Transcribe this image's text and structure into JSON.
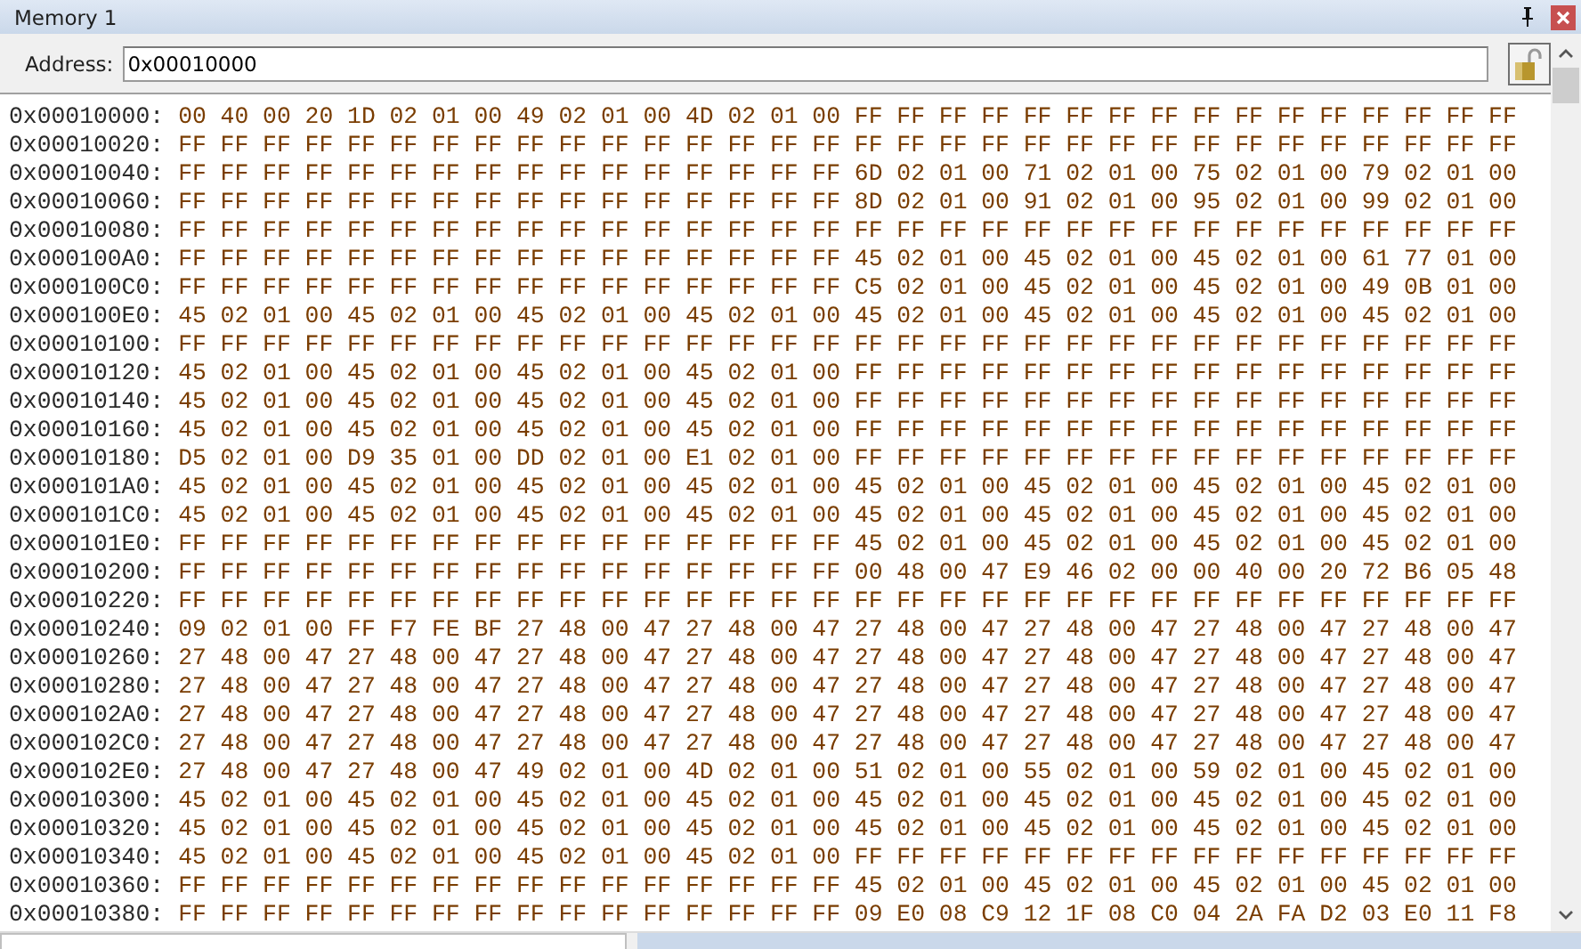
{
  "window": {
    "title": "Memory 1"
  },
  "address": {
    "label": "Address:",
    "value": "0x00010000"
  },
  "rows": [
    {
      "address": "0x00010000:",
      "bytes": "00 40 00 20 1D 02 01 00 49 02 01 00 4D 02 01 00 FF FF FF FF FF FF FF FF FF FF FF FF FF FF FF FF"
    },
    {
      "address": "0x00010020:",
      "bytes": "FF FF FF FF FF FF FF FF FF FF FF FF FF FF FF FF FF FF FF FF FF FF FF FF FF FF FF FF FF FF FF FF"
    },
    {
      "address": "0x00010040:",
      "bytes": "FF FF FF FF FF FF FF FF FF FF FF FF FF FF FF FF 6D 02 01 00 71 02 01 00 75 02 01 00 79 02 01 00"
    },
    {
      "address": "0x00010060:",
      "bytes": "FF FF FF FF FF FF FF FF FF FF FF FF FF FF FF FF 8D 02 01 00 91 02 01 00 95 02 01 00 99 02 01 00"
    },
    {
      "address": "0x00010080:",
      "bytes": "FF FF FF FF FF FF FF FF FF FF FF FF FF FF FF FF FF FF FF FF FF FF FF FF FF FF FF FF FF FF FF FF"
    },
    {
      "address": "0x000100A0:",
      "bytes": "FF FF FF FF FF FF FF FF FF FF FF FF FF FF FF FF 45 02 01 00 45 02 01 00 45 02 01 00 61 77 01 00"
    },
    {
      "address": "0x000100C0:",
      "bytes": "FF FF FF FF FF FF FF FF FF FF FF FF FF FF FF FF C5 02 01 00 45 02 01 00 45 02 01 00 49 0B 01 00"
    },
    {
      "address": "0x000100E0:",
      "bytes": "45 02 01 00 45 02 01 00 45 02 01 00 45 02 01 00 45 02 01 00 45 02 01 00 45 02 01 00 45 02 01 00"
    },
    {
      "address": "0x00010100:",
      "bytes": "FF FF FF FF FF FF FF FF FF FF FF FF FF FF FF FF FF FF FF FF FF FF FF FF FF FF FF FF FF FF FF FF"
    },
    {
      "address": "0x00010120:",
      "bytes": "45 02 01 00 45 02 01 00 45 02 01 00 45 02 01 00 FF FF FF FF FF FF FF FF FF FF FF FF FF FF FF FF"
    },
    {
      "address": "0x00010140:",
      "bytes": "45 02 01 00 45 02 01 00 45 02 01 00 45 02 01 00 FF FF FF FF FF FF FF FF FF FF FF FF FF FF FF FF"
    },
    {
      "address": "0x00010160:",
      "bytes": "45 02 01 00 45 02 01 00 45 02 01 00 45 02 01 00 FF FF FF FF FF FF FF FF FF FF FF FF FF FF FF FF"
    },
    {
      "address": "0x00010180:",
      "bytes": "D5 02 01 00 D9 35 01 00 DD 02 01 00 E1 02 01 00 FF FF FF FF FF FF FF FF FF FF FF FF FF FF FF FF"
    },
    {
      "address": "0x000101A0:",
      "bytes": "45 02 01 00 45 02 01 00 45 02 01 00 45 02 01 00 45 02 01 00 45 02 01 00 45 02 01 00 45 02 01 00"
    },
    {
      "address": "0x000101C0:",
      "bytes": "45 02 01 00 45 02 01 00 45 02 01 00 45 02 01 00 45 02 01 00 45 02 01 00 45 02 01 00 45 02 01 00"
    },
    {
      "address": "0x000101E0:",
      "bytes": "FF FF FF FF FF FF FF FF FF FF FF FF FF FF FF FF 45 02 01 00 45 02 01 00 45 02 01 00 45 02 01 00"
    },
    {
      "address": "0x00010200:",
      "bytes": "FF FF FF FF FF FF FF FF FF FF FF FF FF FF FF FF 00 48 00 47 E9 46 02 00 00 40 00 20 72 B6 05 48"
    },
    {
      "address": "0x00010220:",
      "bytes": "FF FF FF FF FF FF FF FF FF FF FF FF FF FF FF FF FF FF FF FF FF FF FF FF FF FF FF FF FF FF FF FF"
    },
    {
      "address": "0x00010240:",
      "bytes": "09 02 01 00 FF F7 FE BF 27 48 00 47 27 48 00 47 27 48 00 47 27 48 00 47 27 48 00 47 27 48 00 47"
    },
    {
      "address": "0x00010260:",
      "bytes": "27 48 00 47 27 48 00 47 27 48 00 47 27 48 00 47 27 48 00 47 27 48 00 47 27 48 00 47 27 48 00 47"
    },
    {
      "address": "0x00010280:",
      "bytes": "27 48 00 47 27 48 00 47 27 48 00 47 27 48 00 47 27 48 00 47 27 48 00 47 27 48 00 47 27 48 00 47"
    },
    {
      "address": "0x000102A0:",
      "bytes": "27 48 00 47 27 48 00 47 27 48 00 47 27 48 00 47 27 48 00 47 27 48 00 47 27 48 00 47 27 48 00 47"
    },
    {
      "address": "0x000102C0:",
      "bytes": "27 48 00 47 27 48 00 47 27 48 00 47 27 48 00 47 27 48 00 47 27 48 00 47 27 48 00 47 27 48 00 47"
    },
    {
      "address": "0x000102E0:",
      "bytes": "27 48 00 47 27 48 00 47 49 02 01 00 4D 02 01 00 51 02 01 00 55 02 01 00 59 02 01 00 45 02 01 00"
    },
    {
      "address": "0x00010300:",
      "bytes": "45 02 01 00 45 02 01 00 45 02 01 00 45 02 01 00 45 02 01 00 45 02 01 00 45 02 01 00 45 02 01 00"
    },
    {
      "address": "0x00010320:",
      "bytes": "45 02 01 00 45 02 01 00 45 02 01 00 45 02 01 00 45 02 01 00 45 02 01 00 45 02 01 00 45 02 01 00"
    },
    {
      "address": "0x00010340:",
      "bytes": "45 02 01 00 45 02 01 00 45 02 01 00 45 02 01 00 FF FF FF FF FF FF FF FF FF FF FF FF FF FF FF FF"
    },
    {
      "address": "0x00010360:",
      "bytes": "FF FF FF FF FF FF FF FF FF FF FF FF FF FF FF FF 45 02 01 00 45 02 01 00 45 02 01 00 45 02 01 00"
    },
    {
      "address": "0x00010380:",
      "bytes": "FF FF FF FF FF FF FF FF FF FF FF FF FF FF FF FF 09 E0 08 C9 12 1F 08 C0 04 2A FA D2 03 E0 11 F8"
    }
  ]
}
